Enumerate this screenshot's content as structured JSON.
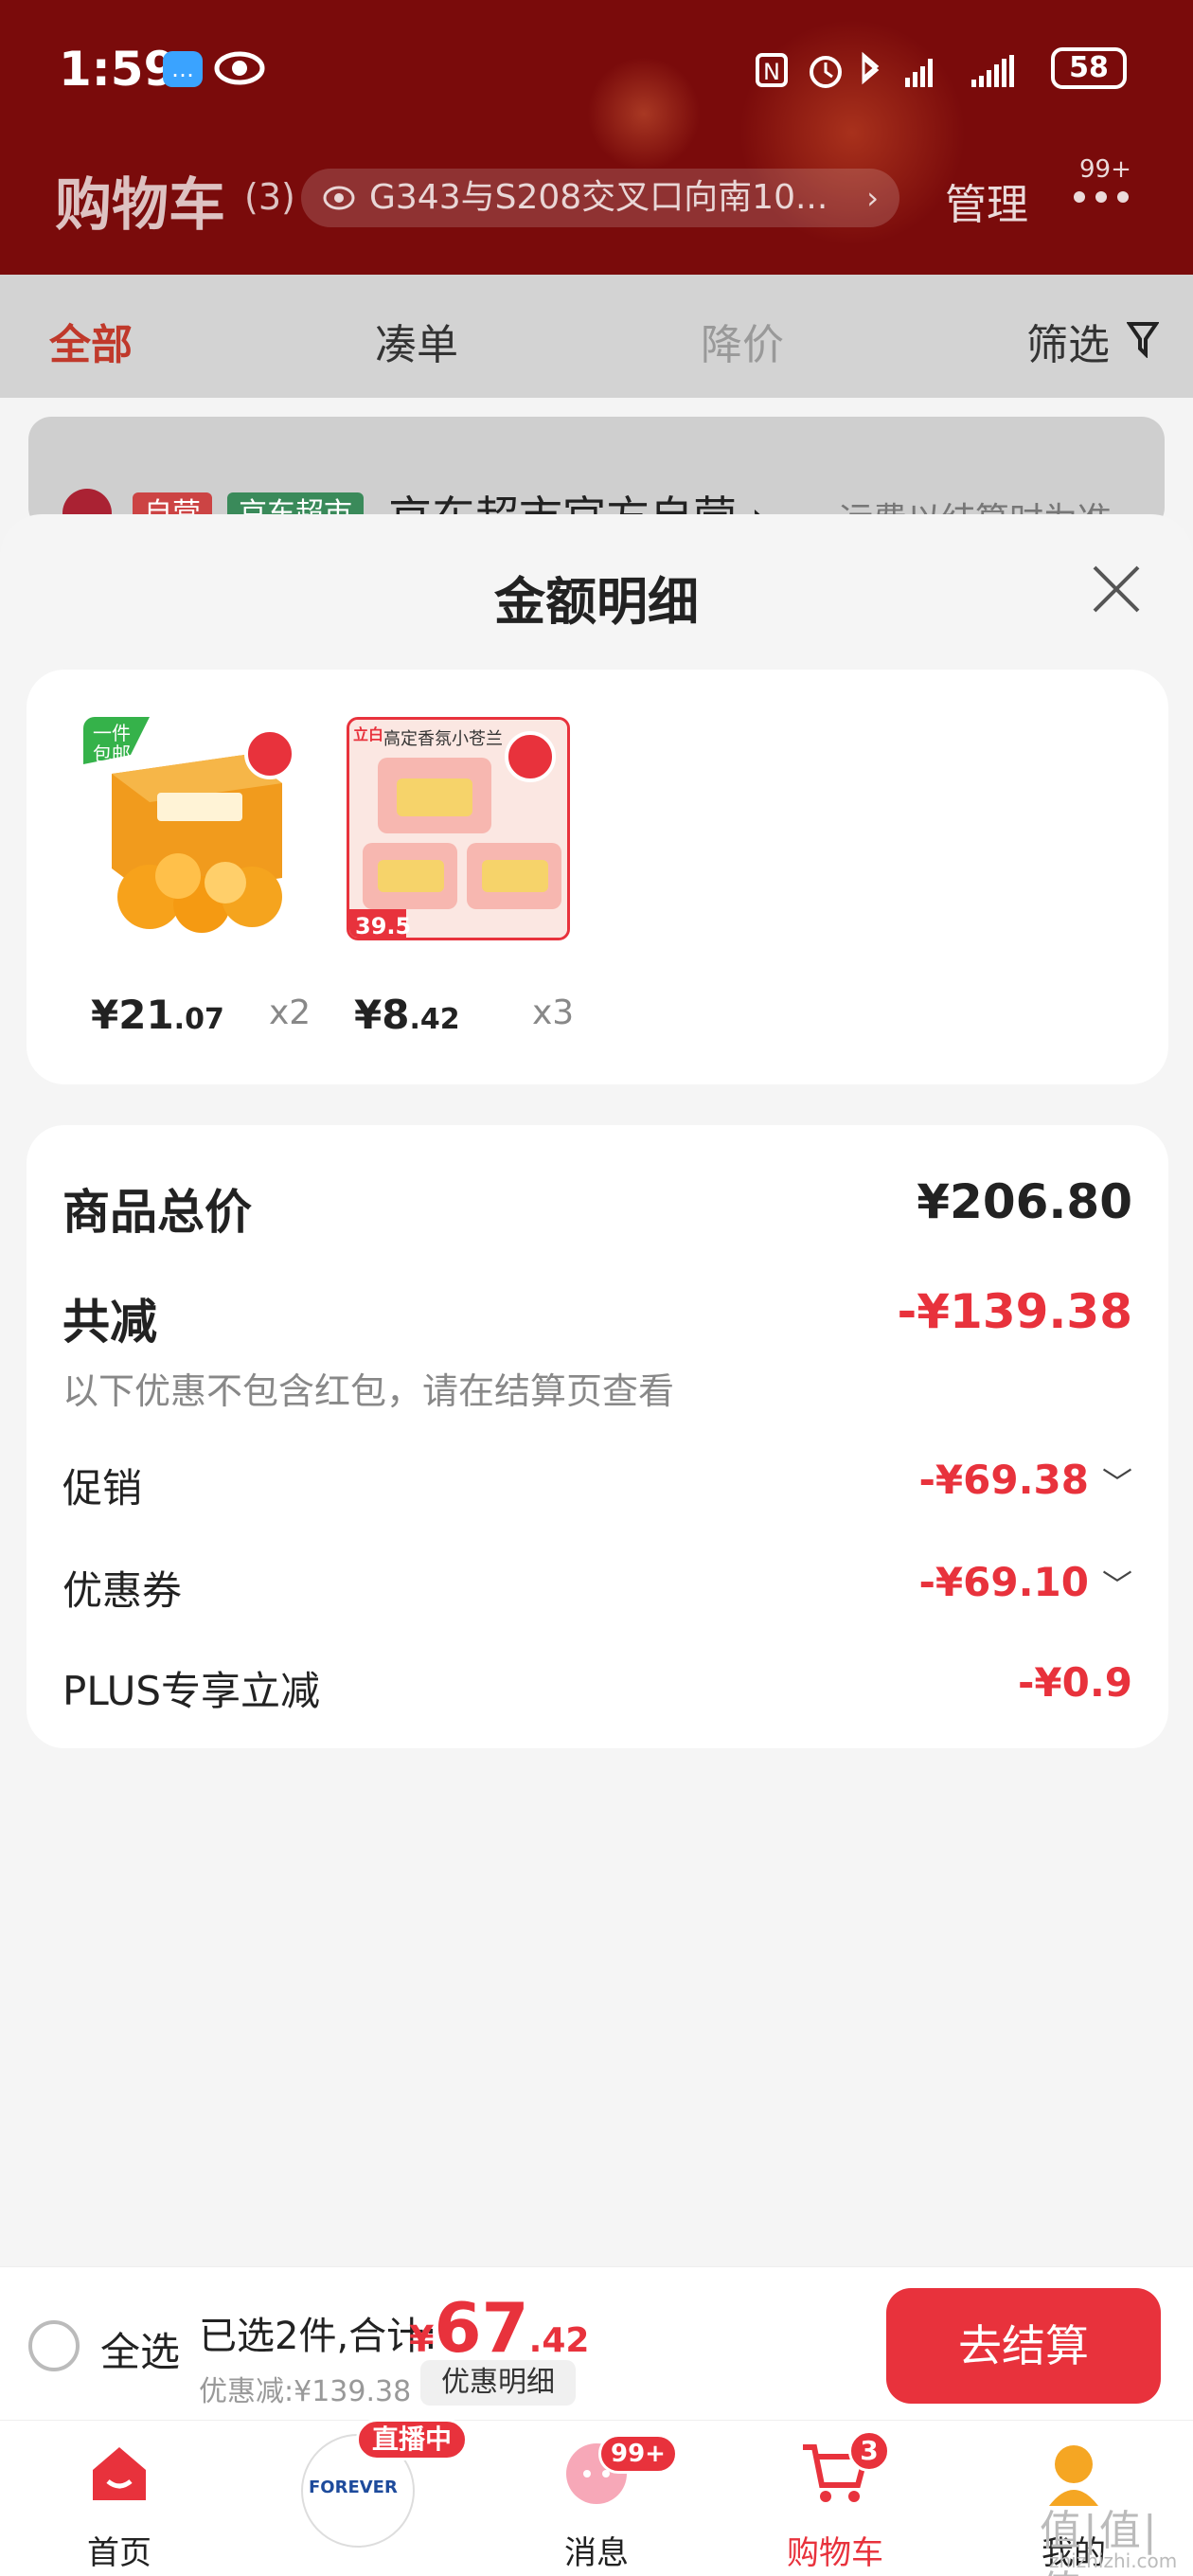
{
  "status_bar": {
    "time": "1:59",
    "battery": "58"
  },
  "header": {
    "title": "购物车",
    "count": "(3)",
    "address": "G343与S208交叉口向南10...",
    "manage": "管理",
    "more_badge": "99+"
  },
  "tabs": [
    {
      "label": "全部"
    },
    {
      "label": "凑单"
    },
    {
      "label": "降价"
    },
    {
      "label": "筛选"
    }
  ],
  "store": {
    "tag_self": "自营",
    "tag_market": "京东超市",
    "name": "京东超市官方自营 ›",
    "note": "运费以结算时为准"
  },
  "sheet": {
    "title": "金额明细",
    "products": [
      {
        "name": "赣南脐橙",
        "tag": "一件包邮",
        "price_int": "¥21",
        "price_dec": ".07",
        "qty": "x2"
      },
      {
        "name": "高定香氛小苍兰",
        "brand": "立白",
        "promo_price": "39.5",
        "price_int": "¥8",
        "price_dec": ".42",
        "qty": "x3"
      }
    ],
    "total": {
      "label": "商品总价",
      "value": "¥206.80"
    },
    "reduce": {
      "label": "共减",
      "value": "-¥139.38",
      "note": "以下优惠不包含红包，请在结算页查看"
    },
    "promo": {
      "label": "促销",
      "value": "-¥69.38"
    },
    "coupon": {
      "label": "优惠券",
      "value": "-¥69.10"
    },
    "plus": {
      "label": "PLUS专享立减",
      "value": "-¥0.9"
    }
  },
  "checkout": {
    "select_all": "全选",
    "summary": "已选2件,合计:",
    "currency": "¥",
    "amount_int": "67",
    "amount_dec": ".42",
    "saved": "优惠减:¥139.38",
    "detail_button": "优惠明细",
    "pay_button": "去结算"
  },
  "nav": {
    "home": "首页",
    "live_badge": "直播中",
    "live_brand": "FOREVER",
    "messages": "消息",
    "messages_badge": "99+",
    "cart": "购物车",
    "cart_badge": "3",
    "me": "我的"
  },
  "watermark": "值|值|值",
  "watermark_site": "zhizhizhi.com",
  "colors": {
    "accent": "#e8323c",
    "header_bg": "#7a0b0b"
  }
}
